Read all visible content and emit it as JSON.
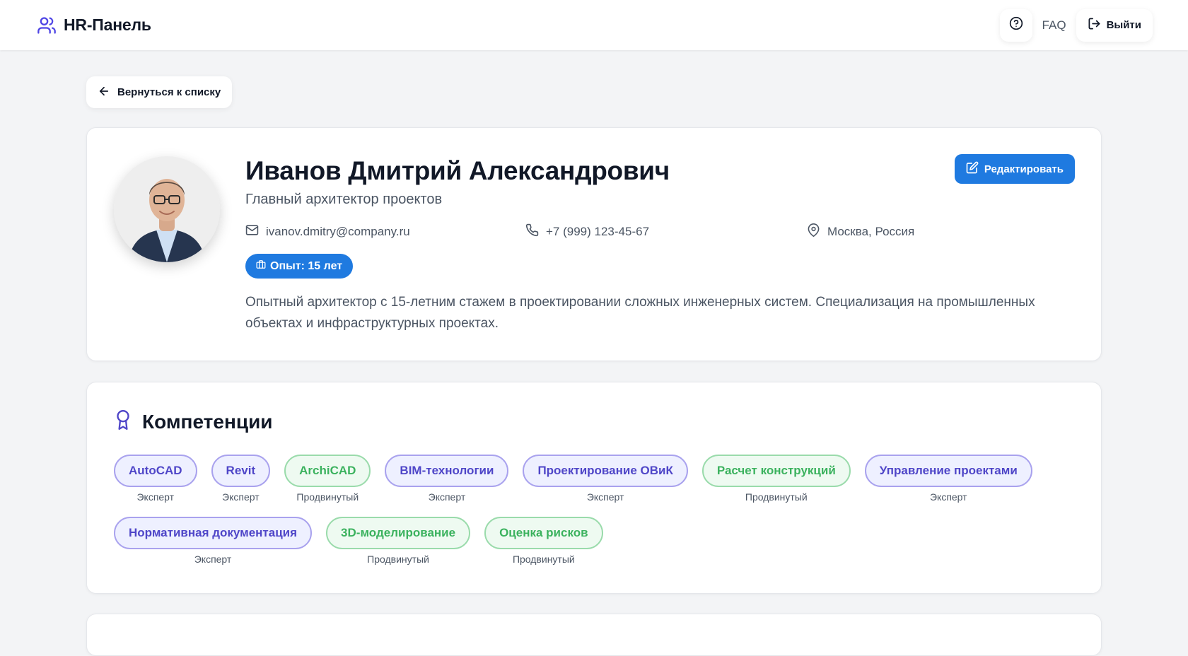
{
  "header": {
    "title": "HR-Панель",
    "faq": "FAQ",
    "logout": "Выйти"
  },
  "back": {
    "label": "Вернуться к списку"
  },
  "profile": {
    "name": "Иванов Дмитрий Александрович",
    "position": "Главный архитектор проектов",
    "email": "ivanov.dmitry@company.ru",
    "phone": "+7 (999) 123-45-67",
    "location": "Москва, Россия",
    "experience": "Опыт: 15 лет",
    "bio": "Опытный архитектор с 15-летним стажем в проектировании сложных инженерных систем. Специализация на промышленных объектах и инфраструктурных проектах.",
    "edit": "Редактировать"
  },
  "skills": {
    "title": "Компетенции",
    "items": [
      {
        "name": "AutoCAD",
        "level": "Эксперт"
      },
      {
        "name": "Revit",
        "level": "Эксперт"
      },
      {
        "name": "ArchiCAD",
        "level": "Продвинутый"
      },
      {
        "name": "BIM-технологии",
        "level": "Эксперт"
      },
      {
        "name": "Проектирование ОВиК",
        "level": "Эксперт"
      },
      {
        "name": "Расчет конструкций",
        "level": "Продвинутый"
      },
      {
        "name": "Управление проектами",
        "level": "Эксперт"
      },
      {
        "name": "Нормативная документация",
        "level": "Эксперт"
      },
      {
        "name": "3D-моделирование",
        "level": "Продвинутый"
      },
      {
        "name": "Оценка рисков",
        "level": "Продвинутый"
      }
    ]
  },
  "colors": {
    "accent": "#1f7ae0",
    "brand_icon": "#4f46e5",
    "expert": "#4f46c8",
    "advanced": "#3bb25e"
  },
  "icons": {
    "brand": "users-icon",
    "help": "question-circle-icon",
    "logout": "log-out-icon",
    "back": "arrow-left-icon",
    "email": "mail-icon",
    "phone": "phone-icon",
    "location": "map-pin-icon",
    "experience": "briefcase-icon",
    "edit": "edit-icon",
    "skills": "award-icon"
  }
}
